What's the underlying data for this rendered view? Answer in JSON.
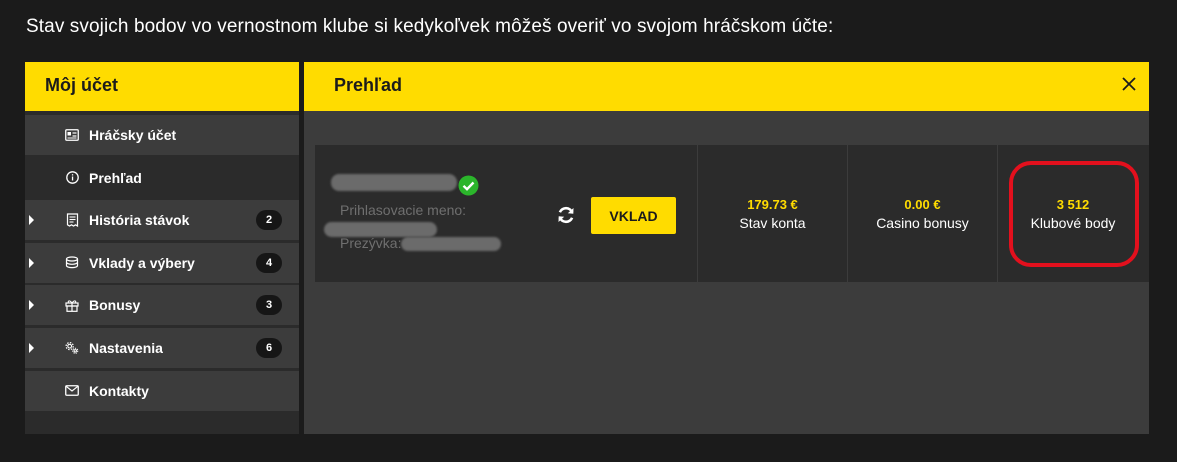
{
  "intro_text": "Stav svojich bodov vo vernostnom klube si kedykoľvek môžeš overiť vo svojom hráčskom účte:",
  "sidebar": {
    "title": "Môj účet",
    "items": [
      {
        "label": "Hráčsky účet",
        "icon": "id-card-icon",
        "badge": null,
        "expandable": false,
        "active": false
      },
      {
        "label": "Prehľad",
        "icon": "info-icon",
        "badge": null,
        "expandable": false,
        "active": true
      },
      {
        "label": "História stávok",
        "icon": "receipt-icon",
        "badge": "2",
        "expandable": true,
        "active": false
      },
      {
        "label": "Vklady a výbery",
        "icon": "coins-icon",
        "badge": "4",
        "expandable": true,
        "active": false
      },
      {
        "label": "Bonusy",
        "icon": "gift-icon",
        "badge": "3",
        "expandable": true,
        "active": false
      },
      {
        "label": "Nastavenia",
        "icon": "gears-icon",
        "badge": "6",
        "expandable": true,
        "active": false
      },
      {
        "label": "Kontakty",
        "icon": "envelope-icon",
        "badge": null,
        "expandable": false,
        "active": false
      }
    ]
  },
  "main": {
    "title": "Prehľad",
    "close_icon": "close-icon",
    "user": {
      "login_label": "Prihlasovacie meno:",
      "nickname_label": "Prezývka:",
      "verified_icon": "check-circle-icon"
    },
    "refresh_icon": "refresh-icon",
    "deposit_label": "VKLAD",
    "stats": [
      {
        "value": "179.73 €",
        "label": "Stav konta"
      },
      {
        "value": "0.00 €",
        "label": "Casino bonusy"
      },
      {
        "value": "3 512",
        "label": "Klubové body",
        "highlighted": true
      }
    ]
  },
  "colors": {
    "accent": "#ffdc00",
    "highlight": "#e3101d",
    "verified": "#2bb52b"
  }
}
